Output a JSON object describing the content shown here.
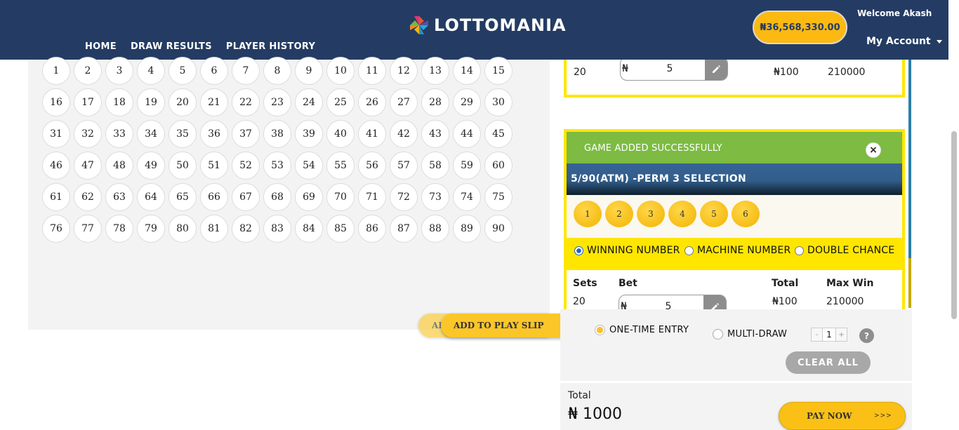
{
  "header": {
    "logo_text": "LOTTOMANIA",
    "nav": [
      "HOME",
      "DRAW RESULTS",
      "PLAYER HISTORY"
    ],
    "balance": "₦36,568,330.00",
    "welcome": "Welcome Akash",
    "account": "My Account"
  },
  "grid": {
    "numbers": [
      "1",
      "2",
      "3",
      "4",
      "5",
      "6",
      "7",
      "8",
      "9",
      "10",
      "11",
      "12",
      "13",
      "14",
      "15",
      "16",
      "17",
      "18",
      "19",
      "20",
      "21",
      "22",
      "23",
      "24",
      "25",
      "26",
      "27",
      "28",
      "29",
      "30",
      "31",
      "32",
      "33",
      "34",
      "35",
      "36",
      "37",
      "38",
      "39",
      "40",
      "41",
      "42",
      "43",
      "44",
      "45",
      "46",
      "47",
      "48",
      "49",
      "50",
      "51",
      "52",
      "53",
      "54",
      "55",
      "56",
      "57",
      "58",
      "59",
      "60",
      "61",
      "62",
      "63",
      "64",
      "65",
      "66",
      "67",
      "68",
      "69",
      "70",
      "71",
      "72",
      "73",
      "74",
      "75",
      "76",
      "77",
      "78",
      "79",
      "80",
      "81",
      "82",
      "83",
      "84",
      "85",
      "86",
      "87",
      "88",
      "89",
      "90"
    ],
    "add_label": "ADD TO PLAY SLIP",
    "arrows": ">>>"
  },
  "slip": {
    "card1": {
      "sets": "20",
      "currency": "₦",
      "bet": "5",
      "total": "₦100",
      "max_win": "210000"
    },
    "card2": {
      "success": "GAME ADDED SUCCESSFULLY",
      "close": "×",
      "game_title": "5/90(ATM) -PERM 3 SELECTION",
      "selected": [
        "1",
        "2",
        "3",
        "4",
        "5",
        "6"
      ],
      "options": [
        "WINNING NUMBER",
        "MACHINE NUMBER",
        "DOUBLE CHANCE"
      ],
      "headers": {
        "sets": "Sets",
        "bet": "Bet",
        "total": "Total",
        "max_win": "Max Win"
      },
      "sets": "20",
      "currency": "₦",
      "bet": "5",
      "total": "₦100",
      "max_win": "210000"
    }
  },
  "controls": {
    "one_time": "ONE-TIME ENTRY",
    "multi_draw": "MULTI-DRAW",
    "minus": "-",
    "draws": "1",
    "plus": "+",
    "help": "?",
    "clear": "CLEAR ALL"
  },
  "total": {
    "label": "Total",
    "value": "₦ 1000",
    "pay": "PAY NOW",
    "arrows": ">>>"
  },
  "colors": {
    "header_bg": "#243c63",
    "accent_yellow": "#fbc015",
    "success_green": "#7dbb43",
    "game_blue": "#315d8a",
    "option_yellow": "#ffe600"
  }
}
